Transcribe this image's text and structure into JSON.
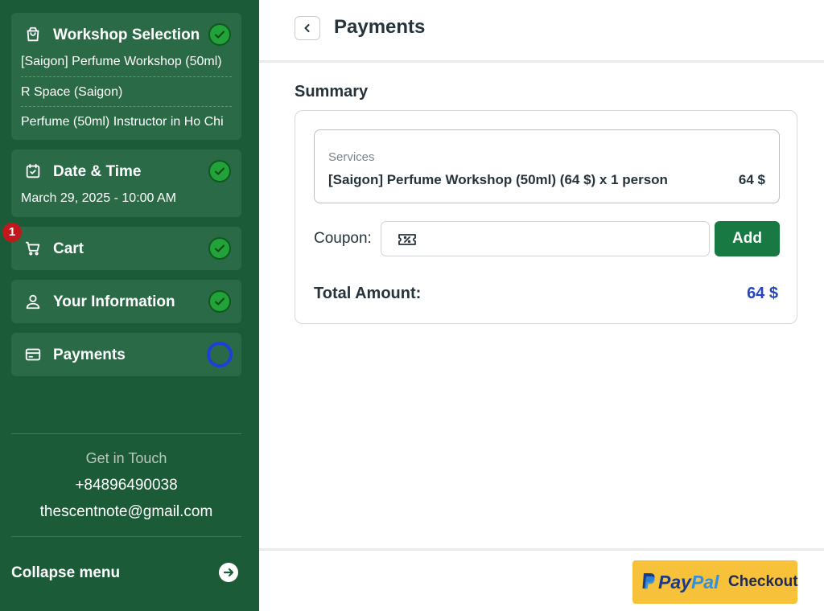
{
  "sidebar": {
    "steps": {
      "workshop": {
        "title": "Workshop Selection",
        "lines": [
          "[Saigon] Perfume Workshop (50ml)",
          "R Space (Saigon)",
          "Perfume (50ml) Instructor in Ho Chi"
        ],
        "icon": "shopping-bag-icon",
        "status": "done"
      },
      "datetime": {
        "title": "Date & Time",
        "lines": [
          "March 29, 2025 - 10:00 AM"
        ],
        "icon": "calendar-icon",
        "status": "done"
      },
      "cart": {
        "title": "Cart",
        "badge": "1",
        "icon": "cart-icon",
        "status": "done"
      },
      "info": {
        "title": "Your Information",
        "icon": "user-icon",
        "status": "done"
      },
      "payments": {
        "title": "Payments",
        "icon": "card-icon",
        "status": "current"
      }
    },
    "contact": {
      "title": "Get in Touch",
      "phone": "+84896490038",
      "email": "thescentnote@gmail.com"
    },
    "collapse_label": "Collapse menu"
  },
  "header": {
    "title": "Payments"
  },
  "summary": {
    "title": "Summary",
    "services_label": "Services",
    "service_item": "[Saigon] Perfume Workshop (50ml) (64 $) x 1 person",
    "service_price": "64 $",
    "coupon_label": "Coupon:",
    "coupon_value": "",
    "add_label": "Add",
    "total_label": "Total Amount:",
    "total_value": "64 $"
  },
  "checkout": {
    "paypal_word_a": "Pay",
    "paypal_word_b": "Pal",
    "label": "Checkout"
  },
  "colors": {
    "sidebar_bg": "#1b5b37",
    "card_bg": "#2a6a46",
    "accent_green": "#187a42",
    "total_blue": "#2446c6",
    "paypal_yellow": "#f8c13a"
  }
}
